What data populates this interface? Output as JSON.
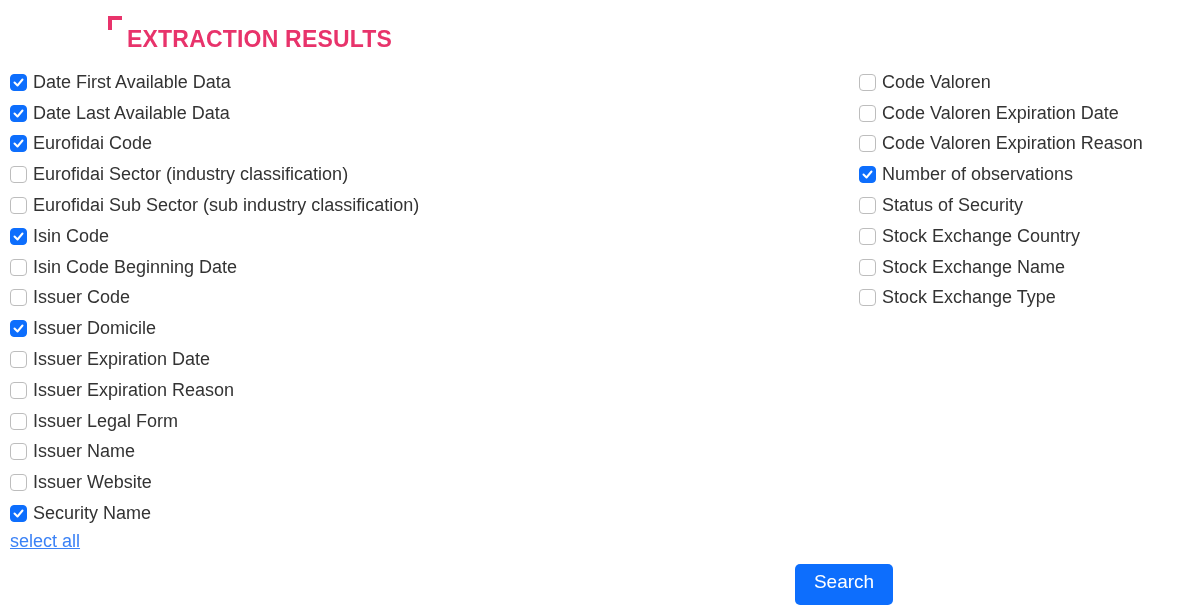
{
  "title": "EXTRACTION RESULTS",
  "columns": [
    [
      {
        "label": "Date First Available Data",
        "checked": true
      },
      {
        "label": "Date Last Available Data",
        "checked": true
      },
      {
        "label": "Eurofidai Code",
        "checked": true
      },
      {
        "label": "Eurofidai Sector (industry classification)",
        "checked": false
      },
      {
        "label": "Eurofidai Sub Sector (sub industry classification)",
        "checked": false
      },
      {
        "label": "Isin Code",
        "checked": true
      },
      {
        "label": "Isin Code Beginning Date",
        "checked": false
      },
      {
        "label": "Issuer Code",
        "checked": false
      },
      {
        "label": "Issuer Domicile",
        "checked": true
      },
      {
        "label": "Issuer Expiration Date",
        "checked": false
      },
      {
        "label": "Issuer Expiration Reason",
        "checked": false
      },
      {
        "label": "Issuer Legal Form",
        "checked": false
      },
      {
        "label": "Issuer Name",
        "checked": false
      },
      {
        "label": "Issuer Website",
        "checked": false
      },
      {
        "label": "Security Name",
        "checked": true
      }
    ],
    [
      {
        "label": "Code Valoren",
        "checked": false
      },
      {
        "label": "Code Valoren Expiration Date",
        "checked": false
      },
      {
        "label": "Code Valoren Expiration Reason",
        "checked": false
      },
      {
        "label": "Number of observations",
        "checked": true
      },
      {
        "label": "Status of Security",
        "checked": false
      },
      {
        "label": "Stock Exchange Country",
        "checked": false
      },
      {
        "label": "Stock Exchange Name",
        "checked": false
      },
      {
        "label": "Stock Exchange Type",
        "checked": false
      }
    ]
  ],
  "select_all": "select all",
  "search_button": "Search"
}
